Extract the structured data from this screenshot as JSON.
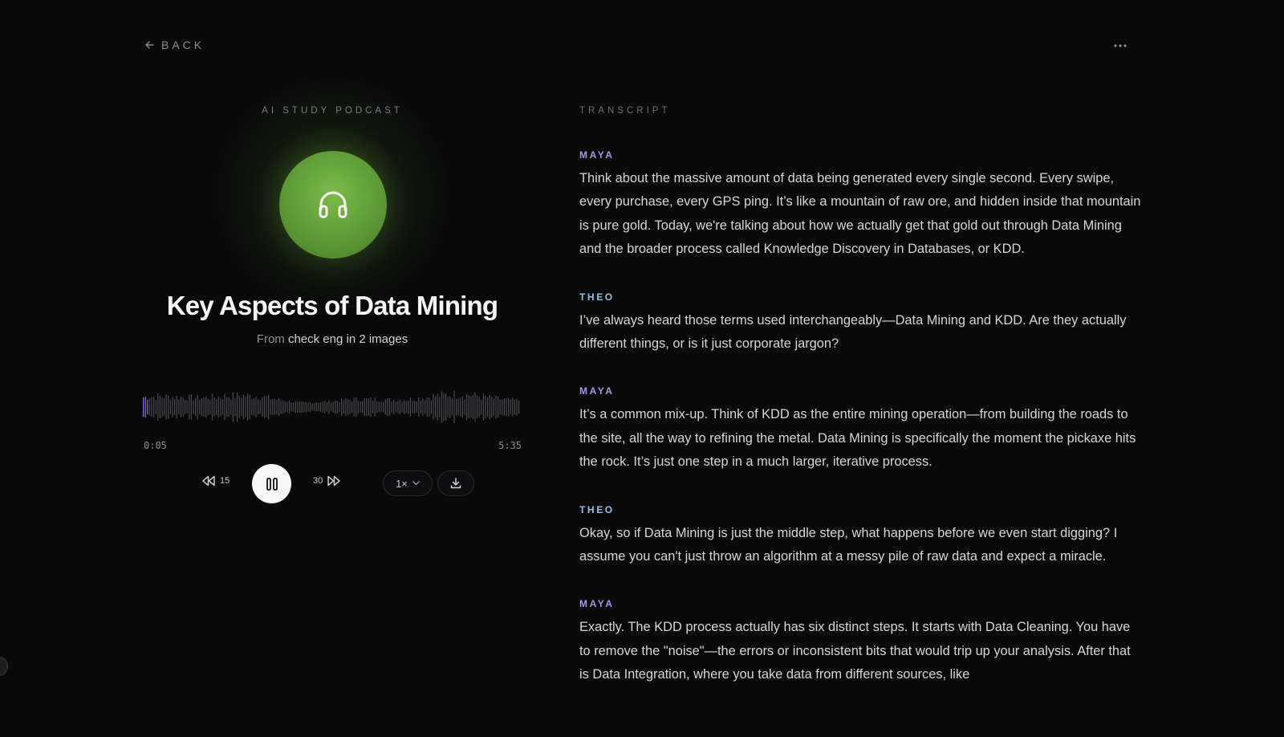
{
  "nav": {
    "back_label": "BACK",
    "back_icon": "arrow-left-icon",
    "more_icon": "ellipsis-icon"
  },
  "player": {
    "kicker": "AI STUDY PODCAST",
    "cover_icon": "headphones-icon",
    "title": "Key Aspects of Data Mining",
    "source_prefix": "From",
    "source_name": "check eng in 2 images",
    "elapsed": "0:05",
    "total": "5:35",
    "progress_fraction": 0.015,
    "skip_back_seconds": "15",
    "skip_forward_seconds": "30",
    "speed": "1×",
    "state": "playing",
    "colors": {
      "cover": "#5e9a36",
      "waveform_played": "#8b6fe0",
      "waveform_unplayed": "#4a4a50"
    }
  },
  "transcript": {
    "label": "TRANSCRIPT",
    "speaker_colors": {
      "MAYA": "#a995ec",
      "THEO": "#96c0ec"
    },
    "turns": [
      {
        "speaker": "MAYA",
        "text": "Think about the massive amount of data being generated every single second. Every swipe, every purchase, every GPS ping. It’s like a mountain of raw ore, and hidden inside that mountain is pure gold. Today, we're talking about how we actually get that gold out through Data Mining and the broader process called Knowledge Discovery in Databases, or KDD."
      },
      {
        "speaker": "THEO",
        "text": "I’ve always heard those terms used interchangeably—Data Mining and KDD. Are they actually different things, or is it just corporate jargon?"
      },
      {
        "speaker": "MAYA",
        "text": "It’s a common mix-up. Think of KDD as the entire mining operation—from building the roads to the site, all the way to refining the metal. Data Mining is specifically the moment the pickaxe hits the rock. It’s just one step in a much larger, iterative process."
      },
      {
        "speaker": "THEO",
        "text": "Okay, so if Data Mining is just the middle step, what happens before we even start digging? I assume you can't just throw an algorithm at a messy pile of raw data and expect a miracle."
      },
      {
        "speaker": "MAYA",
        "text": "Exactly. The KDD process actually has six distinct steps. It starts with Data Cleaning. You have to remove the \"noise\"—the errors or inconsistent bits that would trip up your analysis. After that is Data Integration, where you take data from different sources, like"
      }
    ]
  }
}
